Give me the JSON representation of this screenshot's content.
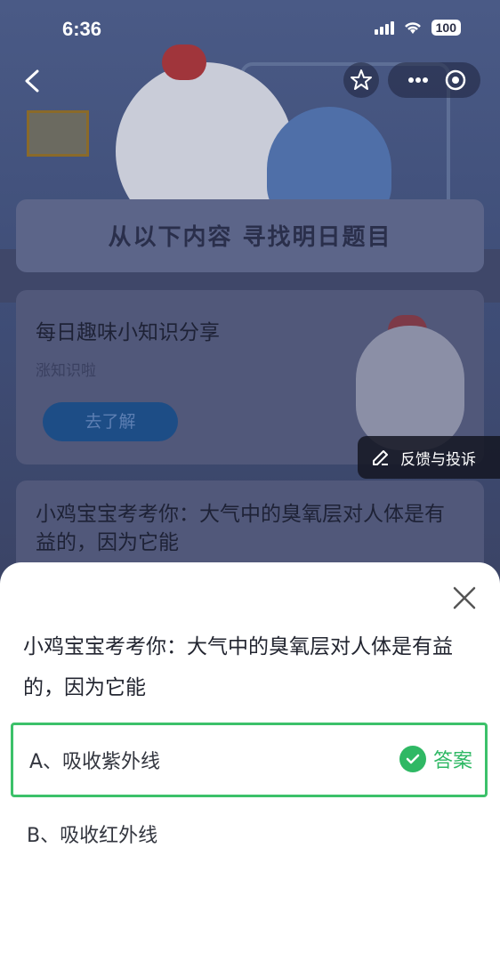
{
  "status_bar": {
    "time": "6:36",
    "battery": "100"
  },
  "banner": {
    "title": "从以下内容 寻找明日题目"
  },
  "card1": {
    "heading": "每日趣味小知识分享",
    "subtitle": "涨知识啦",
    "button_label": "去了解"
  },
  "feedback": {
    "label": "反馈与投诉"
  },
  "card2": {
    "question": "小鸡宝宝考考你：大气中的臭氧层对人体是有益的，因为它能"
  },
  "sheet": {
    "question": "小鸡宝宝考考你：大气中的臭氧层对人体是有益的，因为它能",
    "options": [
      {
        "label": "A、吸收紫外线",
        "badge": "答案"
      },
      {
        "label": "B、吸收红外线"
      }
    ]
  },
  "colors": {
    "accent_green": "#2fb864",
    "border_green": "#3cc16a"
  }
}
